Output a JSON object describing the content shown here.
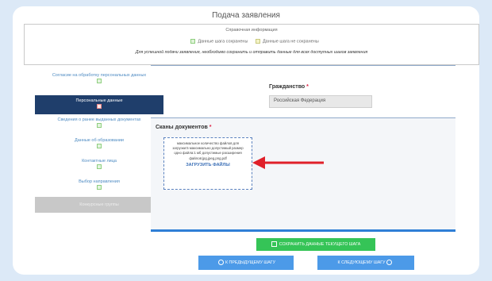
{
  "page": {
    "title": "Подача заявления"
  },
  "info": {
    "title": "Справочная информация",
    "legend_saved": "Данные шага сохранены",
    "legend_unsaved": "Данные шага не сохранены",
    "note": "Для успешной подачи заявления, необходимо сохранить и отправить данные для всех доступных шагов заявления"
  },
  "sidebar": {
    "items": [
      {
        "label": "Согласие на обработку персональных данных",
        "state": "saved"
      },
      {
        "label": "Персональные данные",
        "state": "active"
      },
      {
        "label": "Сведения о ранее выданных документах",
        "state": "saved"
      },
      {
        "label": "Данные об образовании",
        "state": "saved"
      },
      {
        "label": "Контактные лица",
        "state": "saved"
      },
      {
        "label": "Выбор направления",
        "state": "saved"
      },
      {
        "label": "Конкурсные группы",
        "state": "disabled"
      }
    ]
  },
  "form": {
    "citizenship_label": "Гражданство",
    "citizenship_value": "Российская Федерация",
    "required_mark": "*",
    "scans_label": "Сканы документов",
    "upload_info": "максимальное количество файлов для загрузки:5 максимально допустимый размер одно файла:1 мб допустимые расширения файлов:jpg,jpeg,png,pdf",
    "upload_button": "ЗАГРУЗИТЬ ФАЙЛЫ"
  },
  "actions": {
    "save": "СОХРАНИТЬ ДАННЫЕ ТЕКУЩЕГО ШАГА",
    "prev": "К ПРЕДЫДУЩЕМУ ШАГУ",
    "next": "К СЛЕДУЮЩЕМУ ШАГУ"
  },
  "colors": {
    "accent": "#1f3e6b",
    "arrow": "#e0202a",
    "save": "#35c457",
    "nav": "#4c9ae8"
  }
}
